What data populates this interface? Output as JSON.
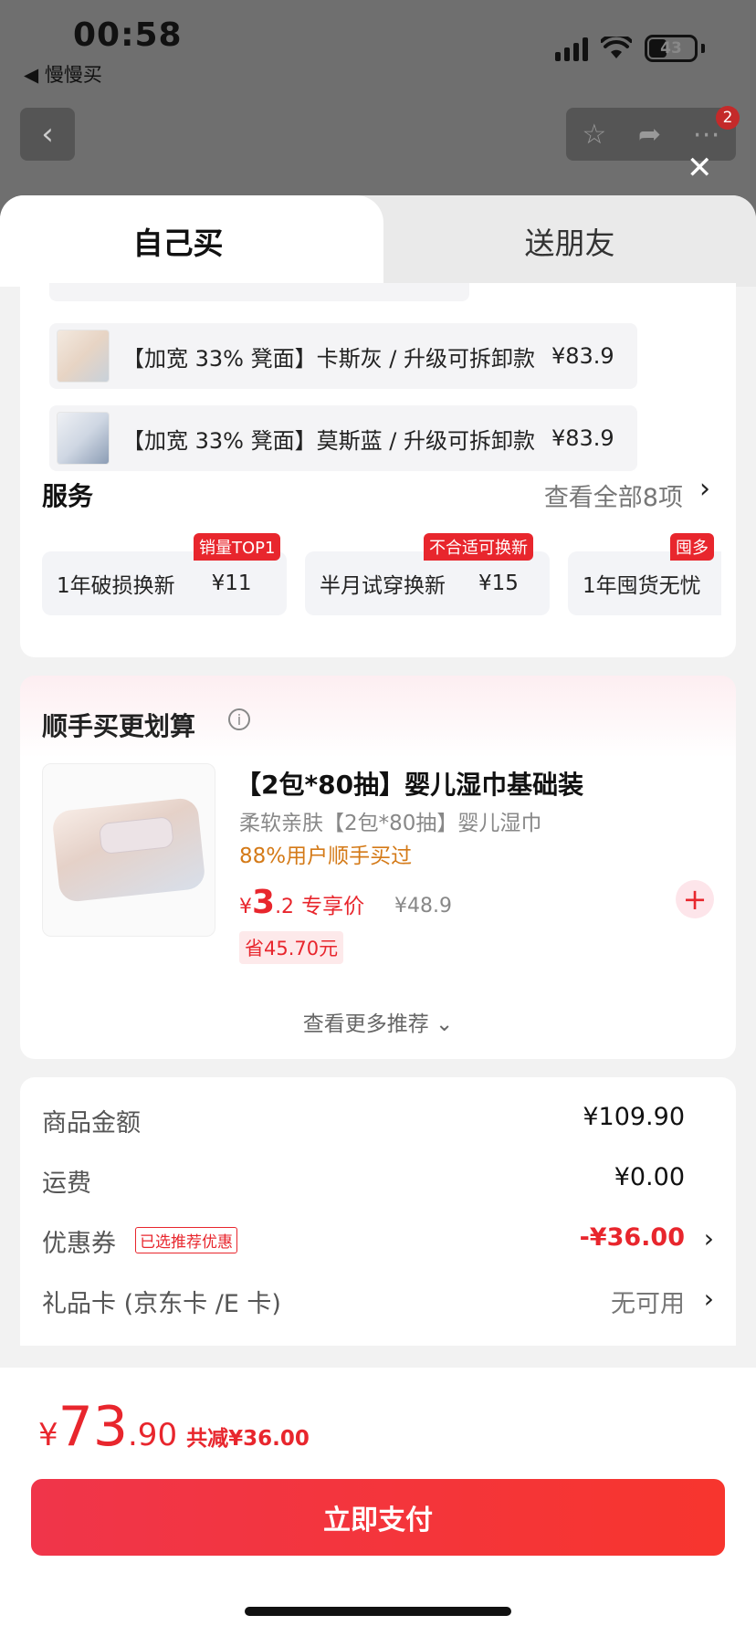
{
  "status": {
    "time": "00:58",
    "back_app": "◀ 慢慢买",
    "battery": "43"
  },
  "nav": {
    "badge": "2"
  },
  "tabs": {
    "self": "自己买",
    "gift": "送朋友"
  },
  "variants": [
    {
      "label": "【加宽 33% 凳面】卡斯灰 / 升级可拆卸款",
      "price": "¥83.9"
    },
    {
      "label": "【加宽 33% 凳面】莫斯蓝 / 升级可拆卸款",
      "price": "¥83.9"
    }
  ],
  "services": {
    "title": "服务",
    "view_all": "查看全部8项",
    "items": [
      {
        "name": "1年破损换新",
        "price": "¥11",
        "tag": "销量TOP1"
      },
      {
        "name": "半月试穿换新",
        "price": "¥15",
        "tag": "不合适可换新"
      },
      {
        "name": "1年囤货无忧",
        "price": "",
        "tag": "囤多"
      }
    ]
  },
  "addon": {
    "title": "顺手买更划算",
    "product_name": "【2包*80抽】婴儿湿巾基础装",
    "subtitle": "柔软亲肤【2包*80抽】婴儿湿巾",
    "user_pct": "88%用户顺手买过",
    "price_yen": "¥",
    "price_int": "3",
    "price_dec": ".2",
    "price_label": "专享价",
    "orig_price": "¥48.9",
    "save": "省45.70元",
    "add": "+",
    "more": "查看更多推荐 ⌄"
  },
  "summary": {
    "goods_label": "商品金额",
    "goods_value": "¥109.90",
    "ship_label": "运费",
    "ship_value": "¥0.00",
    "coupon_label": "优惠券",
    "coupon_tag": "已选推荐优惠",
    "coupon_value": "-¥36.00",
    "giftcard_label": "礼品卡 (京东卡 /E 卡)",
    "giftcard_value": "无可用"
  },
  "bottom": {
    "yen": "¥",
    "total_int": "73",
    "total_dec": ".90",
    "reduce": "共减¥36.00",
    "pay": "立即支付"
  },
  "icons": {
    "back": "chevron-left-icon",
    "star": "star-icon",
    "share": "share-icon",
    "more": "more-icon",
    "close": "close-icon",
    "info": "info-icon",
    "chevron": "chevron-right-icon"
  },
  "colors": {
    "accent": "#e8262d",
    "orange": "#d47a18"
  }
}
